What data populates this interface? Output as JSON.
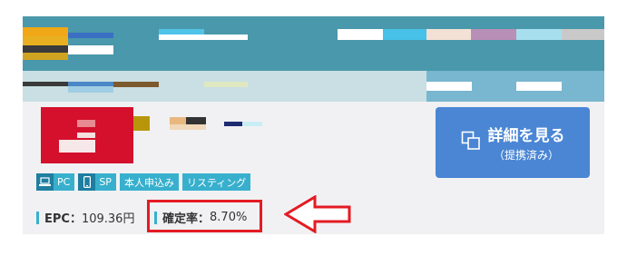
{
  "colors": {
    "header": "#4a98ab",
    "subheader": "#c9dfe3",
    "card_background": "#f1f1f3",
    "tag": "#38b0cd",
    "tag_icon_box": "#1d7ea1",
    "cta": "#4a86d4",
    "annotation": "#e41b23",
    "logo": "#d4102c"
  },
  "tags": [
    {
      "label": "PC",
      "icon": "laptop-icon"
    },
    {
      "label": "SP",
      "icon": "smartphone-icon"
    },
    {
      "label": "本人申込み",
      "icon": null
    },
    {
      "label": "リスティング",
      "icon": null
    }
  ],
  "metrics": {
    "epc_label": "EPC：",
    "epc_value": "109.36円",
    "rate_label": "確定率：",
    "rate_value": "8.70%"
  },
  "cta": {
    "label": "詳細を見る",
    "sublabel": "（提携済み）",
    "icon": "copy-windows-icon"
  },
  "annotation": {
    "arrow_icon": "left-arrow-outline-icon"
  }
}
